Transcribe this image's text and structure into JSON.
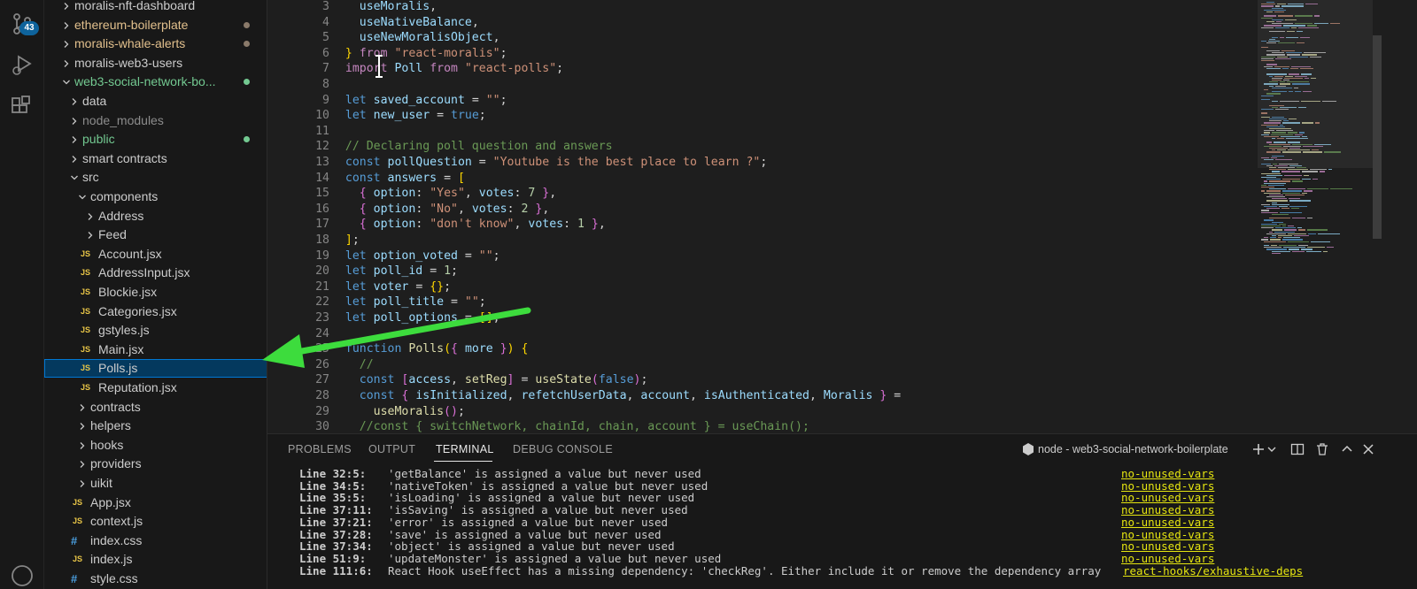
{
  "activity_bar": {
    "scm_badge": "43",
    "icons": [
      "source-control-icon",
      "run-debug-icon",
      "extensions-icon",
      "accounts-icon"
    ]
  },
  "explorer": {
    "items": [
      {
        "label": "moralis-nft-dashboard",
        "depth": 0,
        "chevron": "right",
        "color": "#cccccc",
        "dot": null
      },
      {
        "label": "ethereum-boilerplate",
        "depth": 0,
        "chevron": "right",
        "color": "#e2c08d",
        "dot": "#8a7a6a"
      },
      {
        "label": "moralis-whale-alerts",
        "depth": 0,
        "chevron": "right",
        "color": "#e2c08d",
        "dot": "#8a7a6a"
      },
      {
        "label": "moralis-web3-users",
        "depth": 0,
        "chevron": "right",
        "color": "#cccccc",
        "dot": null
      },
      {
        "label": "web3-social-network-bo...",
        "depth": 0,
        "chevron": "down",
        "color": "#73c991",
        "dot": "#73c991"
      },
      {
        "label": "data",
        "depth": 1,
        "chevron": "right",
        "color": "#cccccc",
        "dot": null
      },
      {
        "label": "node_modules",
        "depth": 1,
        "chevron": "right",
        "color": "#8c8c8c",
        "dot": null
      },
      {
        "label": "public",
        "depth": 1,
        "chevron": "right",
        "color": "#73c991",
        "dot": "#73c991"
      },
      {
        "label": "smart contracts",
        "depth": 1,
        "chevron": "right",
        "color": "#cccccc",
        "dot": null
      },
      {
        "label": "src",
        "depth": 1,
        "chevron": "down",
        "color": "#cccccc",
        "dot": null
      },
      {
        "label": "components",
        "depth": 2,
        "chevron": "down",
        "color": "#cccccc",
        "dot": null
      },
      {
        "label": "Address",
        "depth": 3,
        "chevron": "right",
        "color": "#cccccc",
        "dot": null
      },
      {
        "label": "Feed",
        "depth": 3,
        "chevron": "right",
        "color": "#cccccc",
        "dot": null
      },
      {
        "label": "Account.jsx",
        "depth": 3,
        "icon": "JS",
        "color": "#cccccc",
        "dot": null
      },
      {
        "label": "AddressInput.jsx",
        "depth": 3,
        "icon": "JS",
        "color": "#cccccc",
        "dot": null
      },
      {
        "label": "Blockie.jsx",
        "depth": 3,
        "icon": "JS",
        "color": "#cccccc",
        "dot": null
      },
      {
        "label": "Categories.jsx",
        "depth": 3,
        "icon": "JS",
        "color": "#cccccc",
        "dot": null
      },
      {
        "label": "gstyles.js",
        "depth": 3,
        "icon": "JS",
        "color": "#cccccc",
        "dot": null
      },
      {
        "label": "Main.jsx",
        "depth": 3,
        "icon": "JS",
        "color": "#cccccc",
        "dot": null
      },
      {
        "label": "Polls.js",
        "depth": 3,
        "icon": "JS",
        "color": "#cccccc",
        "dot": null,
        "selected": true
      },
      {
        "label": "Reputation.jsx",
        "depth": 3,
        "icon": "JS",
        "color": "#cccccc",
        "dot": null
      },
      {
        "label": "contracts",
        "depth": 2,
        "chevron": "right",
        "color": "#cccccc",
        "dot": null
      },
      {
        "label": "helpers",
        "depth": 2,
        "chevron": "right",
        "color": "#cccccc",
        "dot": null
      },
      {
        "label": "hooks",
        "depth": 2,
        "chevron": "right",
        "color": "#cccccc",
        "dot": null
      },
      {
        "label": "providers",
        "depth": 2,
        "chevron": "right",
        "color": "#cccccc",
        "dot": null
      },
      {
        "label": "uikit",
        "depth": 2,
        "chevron": "right",
        "color": "#cccccc",
        "dot": null
      },
      {
        "label": "App.jsx",
        "depth": 2,
        "icon": "JS",
        "color": "#cccccc",
        "dot": null
      },
      {
        "label": "context.js",
        "depth": 2,
        "icon": "JS",
        "color": "#cccccc",
        "dot": null
      },
      {
        "label": "index.css",
        "depth": 2,
        "icon": "#",
        "color": "#cccccc",
        "dot": null
      },
      {
        "label": "index.js",
        "depth": 2,
        "icon": "JS",
        "color": "#cccccc",
        "dot": null
      },
      {
        "label": "style.css",
        "depth": 2,
        "icon": "#",
        "color": "#cccccc",
        "dot": null
      }
    ]
  },
  "editor": {
    "lines": [
      {
        "n": "3",
        "tokens": [
          [
            "    ",
            ""
          ],
          [
            "useMoralis",
            "var"
          ],
          [
            ",",
            ""
          ]
        ]
      },
      {
        "n": "4",
        "tokens": [
          [
            "    ",
            ""
          ],
          [
            "useNativeBalance",
            "var"
          ],
          [
            ",",
            ""
          ]
        ]
      },
      {
        "n": "5",
        "tokens": [
          [
            "    ",
            ""
          ],
          [
            "useNewMoralisObject",
            "var"
          ],
          [
            ",",
            ""
          ]
        ]
      },
      {
        "n": "6",
        "tokens": [
          [
            "  ",
            ""
          ],
          [
            "}",
            "b1"
          ],
          [
            " ",
            ""
          ],
          [
            "from",
            "kw"
          ],
          [
            " ",
            ""
          ],
          [
            "\"react-moralis\"",
            "str"
          ],
          [
            ";",
            ""
          ]
        ]
      },
      {
        "n": "7",
        "tokens": [
          [
            "  ",
            ""
          ],
          [
            "import",
            "kw"
          ],
          [
            " ",
            ""
          ],
          [
            "Poll",
            "var"
          ],
          [
            " ",
            ""
          ],
          [
            "from",
            "kw"
          ],
          [
            " ",
            ""
          ],
          [
            "\"react-polls\"",
            "str"
          ],
          [
            ";",
            ""
          ]
        ]
      },
      {
        "n": "8",
        "tokens": []
      },
      {
        "n": "9",
        "tokens": [
          [
            "  ",
            ""
          ],
          [
            "let",
            "st"
          ],
          [
            " ",
            ""
          ],
          [
            "saved_account",
            "var"
          ],
          [
            " = ",
            ""
          ],
          [
            "\"\"",
            "str"
          ],
          [
            ";",
            ""
          ]
        ]
      },
      {
        "n": "10",
        "tokens": [
          [
            "  ",
            ""
          ],
          [
            "let",
            "st"
          ],
          [
            " ",
            ""
          ],
          [
            "new_user",
            "var"
          ],
          [
            " = ",
            ""
          ],
          [
            "true",
            "st"
          ],
          [
            ";",
            ""
          ]
        ]
      },
      {
        "n": "11",
        "tokens": []
      },
      {
        "n": "12",
        "tokens": [
          [
            "  ",
            ""
          ],
          [
            "// Declaring poll question and answers",
            "com"
          ]
        ]
      },
      {
        "n": "13",
        "tokens": [
          [
            "  ",
            ""
          ],
          [
            "const",
            "st"
          ],
          [
            " ",
            ""
          ],
          [
            "pollQuestion",
            "var"
          ],
          [
            " = ",
            ""
          ],
          [
            "\"Youtube is the best place to learn ?\"",
            "str"
          ],
          [
            ";",
            ""
          ]
        ]
      },
      {
        "n": "14",
        "tokens": [
          [
            "  ",
            ""
          ],
          [
            "const",
            "st"
          ],
          [
            " ",
            ""
          ],
          [
            "answers",
            "var"
          ],
          [
            " = ",
            ""
          ],
          [
            "[",
            "b1"
          ]
        ]
      },
      {
        "n": "15",
        "tokens": [
          [
            "    ",
            ""
          ],
          [
            "{",
            "b2"
          ],
          [
            " ",
            ""
          ],
          [
            "option",
            "var"
          ],
          [
            ": ",
            ""
          ],
          [
            "\"Yes\"",
            "str"
          ],
          [
            ", ",
            ""
          ],
          [
            "votes",
            "var"
          ],
          [
            ": ",
            ""
          ],
          [
            "7",
            "num"
          ],
          [
            " ",
            ""
          ],
          [
            "}",
            "b2"
          ],
          [
            ",",
            ""
          ]
        ]
      },
      {
        "n": "16",
        "tokens": [
          [
            "    ",
            ""
          ],
          [
            "{",
            "b2"
          ],
          [
            " ",
            ""
          ],
          [
            "option",
            "var"
          ],
          [
            ": ",
            ""
          ],
          [
            "\"No\"",
            "str"
          ],
          [
            ", ",
            ""
          ],
          [
            "votes",
            "var"
          ],
          [
            ": ",
            ""
          ],
          [
            "2",
            "num"
          ],
          [
            " ",
            ""
          ],
          [
            "}",
            "b2"
          ],
          [
            ",",
            ""
          ]
        ]
      },
      {
        "n": "17",
        "tokens": [
          [
            "    ",
            ""
          ],
          [
            "{",
            "b2"
          ],
          [
            " ",
            ""
          ],
          [
            "option",
            "var"
          ],
          [
            ": ",
            ""
          ],
          [
            "\"don't know\"",
            "str"
          ],
          [
            ", ",
            ""
          ],
          [
            "votes",
            "var"
          ],
          [
            ": ",
            ""
          ],
          [
            "1",
            "num"
          ],
          [
            " ",
            ""
          ],
          [
            "}",
            "b2"
          ],
          [
            ",",
            ""
          ]
        ]
      },
      {
        "n": "18",
        "tokens": [
          [
            "  ",
            ""
          ],
          [
            "]",
            "b1"
          ],
          [
            ";",
            ""
          ]
        ]
      },
      {
        "n": "19",
        "tokens": [
          [
            "  ",
            ""
          ],
          [
            "let",
            "st"
          ],
          [
            " ",
            ""
          ],
          [
            "option_voted",
            "var"
          ],
          [
            " = ",
            ""
          ],
          [
            "\"\"",
            "str"
          ],
          [
            ";",
            ""
          ]
        ]
      },
      {
        "n": "20",
        "tokens": [
          [
            "  ",
            ""
          ],
          [
            "let",
            "st"
          ],
          [
            " ",
            ""
          ],
          [
            "poll_id",
            "var"
          ],
          [
            " = ",
            ""
          ],
          [
            "1",
            "num"
          ],
          [
            ";",
            ""
          ]
        ]
      },
      {
        "n": "21",
        "tokens": [
          [
            "  ",
            ""
          ],
          [
            "let",
            "st"
          ],
          [
            " ",
            ""
          ],
          [
            "voter",
            "var"
          ],
          [
            " = ",
            ""
          ],
          [
            "{}",
            "b1"
          ],
          [
            ";",
            ""
          ]
        ]
      },
      {
        "n": "22",
        "tokens": [
          [
            "  ",
            ""
          ],
          [
            "let",
            "st"
          ],
          [
            " ",
            ""
          ],
          [
            "poll_title",
            "var"
          ],
          [
            " = ",
            ""
          ],
          [
            "\"\"",
            "str"
          ],
          [
            ";",
            ""
          ]
        ]
      },
      {
        "n": "23",
        "tokens": [
          [
            "  ",
            ""
          ],
          [
            "let",
            "st"
          ],
          [
            " ",
            ""
          ],
          [
            "poll_options",
            "var"
          ],
          [
            " = ",
            ""
          ],
          [
            "[]",
            "b1"
          ],
          [
            ";",
            ""
          ]
        ]
      },
      {
        "n": "24",
        "tokens": []
      },
      {
        "n": "25",
        "tokens": [
          [
            "  ",
            ""
          ],
          [
            "function",
            "st"
          ],
          [
            " ",
            ""
          ],
          [
            "Polls",
            "fn"
          ],
          [
            "(",
            "b1"
          ],
          [
            "{",
            "b2"
          ],
          [
            " ",
            ""
          ],
          [
            "more",
            "var"
          ],
          [
            " ",
            ""
          ],
          [
            "}",
            "b2"
          ],
          [
            ")",
            "b1"
          ],
          [
            " ",
            ""
          ],
          [
            "{",
            "b1"
          ]
        ]
      },
      {
        "n": "26",
        "tokens": [
          [
            "    ",
            ""
          ],
          [
            "//",
            "com"
          ]
        ]
      },
      {
        "n": "27",
        "tokens": [
          [
            "    ",
            ""
          ],
          [
            "const",
            "st"
          ],
          [
            " ",
            ""
          ],
          [
            "[",
            "b2"
          ],
          [
            "access",
            "var"
          ],
          [
            ", ",
            ""
          ],
          [
            "setReg",
            "fn"
          ],
          [
            "]",
            "b2"
          ],
          [
            " = ",
            ""
          ],
          [
            "useState",
            "fn"
          ],
          [
            "(",
            "b2"
          ],
          [
            "false",
            "st"
          ],
          [
            ")",
            "b2"
          ],
          [
            ";",
            ""
          ]
        ]
      },
      {
        "n": "28",
        "tokens": [
          [
            "    ",
            ""
          ],
          [
            "const",
            "st"
          ],
          [
            " ",
            ""
          ],
          [
            "{",
            "b2"
          ],
          [
            " ",
            ""
          ],
          [
            "isInitialized",
            "var"
          ],
          [
            ", ",
            ""
          ],
          [
            "refetchUserData",
            "var"
          ],
          [
            ", ",
            ""
          ],
          [
            "account",
            "var"
          ],
          [
            ", ",
            ""
          ],
          [
            "isAuthenticated",
            "var"
          ],
          [
            ", ",
            ""
          ],
          [
            "Moralis",
            "var"
          ],
          [
            " ",
            ""
          ],
          [
            "}",
            "b2"
          ],
          [
            " =",
            ""
          ]
        ]
      },
      {
        "n": "29",
        "tokens": [
          [
            "      ",
            ""
          ],
          [
            "useMoralis",
            "fn"
          ],
          [
            "()",
            "b2"
          ],
          [
            ";",
            ""
          ]
        ]
      },
      {
        "n": "30",
        "tokens": [
          [
            "    ",
            ""
          ],
          [
            "//const { switchNetwork, chainId, chain, account } = useChain();",
            "com"
          ]
        ]
      }
    ]
  },
  "panel": {
    "tabs": [
      "PROBLEMS",
      "OUTPUT",
      "TERMINAL",
      "DEBUG CONSOLE"
    ],
    "active_tab": "TERMINAL",
    "terminal_name": "node - web3-social-network-boilerplate",
    "output": [
      {
        "loc": "Line 32:5:",
        "msg": "'getBalance' is assigned a value but never used",
        "rule": "no-unused-vars"
      },
      {
        "loc": "Line 34:5:",
        "msg": "'nativeToken' is assigned a value but never used",
        "rule": "no-unused-vars"
      },
      {
        "loc": "Line 35:5:",
        "msg": "'isLoading' is assigned a value but never used",
        "rule": "no-unused-vars"
      },
      {
        "loc": "Line 37:11:",
        "msg": "'isSaving' is assigned a value but never used",
        "rule": "no-unused-vars"
      },
      {
        "loc": "Line 37:21:",
        "msg": "'error' is assigned a value but never used",
        "rule": "no-unused-vars"
      },
      {
        "loc": "Line 37:28:",
        "msg": "'save' is assigned a value but never used",
        "rule": "no-unused-vars"
      },
      {
        "loc": "Line 37:34:",
        "msg": "'object' is assigned a value but never used",
        "rule": "no-unused-vars"
      },
      {
        "loc": "Line 51:9:",
        "msg": "'updateMonster' is assigned a value but never used",
        "rule": "no-unused-vars"
      },
      {
        "loc": "Line 111:6:",
        "msg": "React Hook useEffect has a missing dependency: 'checkReg'. Either include it or remove the dependency array",
        "rule": "react-hooks/exhaustive-deps"
      }
    ]
  },
  "colors": {
    "accent": "#0078d4",
    "arrow": "#3ddc3d",
    "selection": "#04395e",
    "git_added": "#73c991",
    "git_modified": "#e2c08d",
    "lint_rule": "#e5e510"
  }
}
